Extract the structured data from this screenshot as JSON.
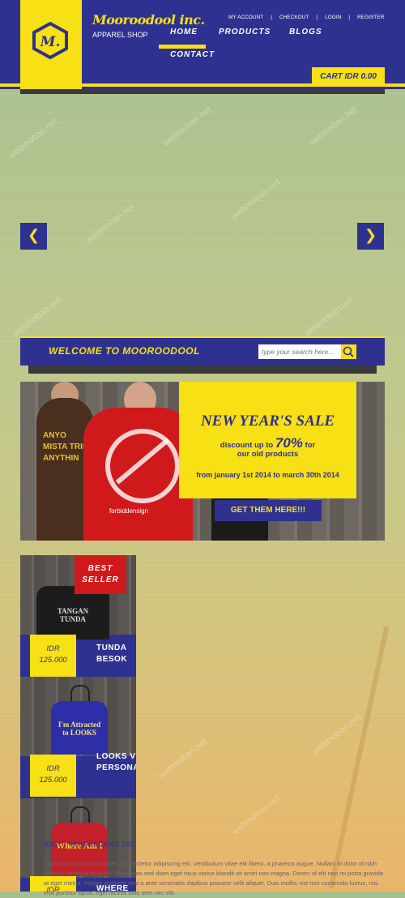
{
  "header": {
    "brand": "Mooroodool inc.",
    "logo_mark": "M.",
    "tagline": "APPAREL SHOP",
    "top_links": [
      "MY ACCOUNT",
      "CHECKOUT",
      "LOGIN",
      "REGISTER"
    ],
    "nav": [
      "HOME",
      "PRODUCTS",
      "BLOGS",
      "CONTACT"
    ],
    "cart_label": "CART IDR 0.00"
  },
  "slider": {
    "prev_icon": "chevron-left-icon",
    "next_icon": "chevron-right-icon",
    "prev": "❮",
    "next": "❯"
  },
  "welcome": {
    "text": "WELCOME TO MOOROODOOL",
    "search_placeholder": "type your search here..."
  },
  "promo": {
    "title": "NEW YEAR'S SALE",
    "line1_pre": "discount up to",
    "percent": "70%",
    "line1_post": "for",
    "line2": "our old products",
    "dates": "from january 1st 2014 to march 30th 2014",
    "cta": "GET THEM HERE!!!",
    "shirt1_text": "ANYO MISTA TRIM ANYTHIN",
    "shirt2_text": "forbiddensign"
  },
  "products": [
    {
      "badge": "BEST SELLER",
      "currency": "IDR",
      "price": "125.000",
      "name": "TUNDA BESOK",
      "shirt_text": "TANGAN TUNDA"
    },
    {
      "currency": "IDR",
      "price": "125.000",
      "name": "LOOKS VS PERSONALITY",
      "shirt_text": "I'm Attracted to LOOKS"
    },
    {
      "currency": "IDR",
      "price": "",
      "name": "WHERE",
      "shirt_text": "Where Am I"
    }
  ],
  "footer": {
    "title": "ABOUT MOOROODOOL INC.",
    "text": "Lorem ipsum dolor sit amet, consectetur adipiscing elit. Vestibulum vitae elit libero, a pharetra augue. Nullam id dolor id nibh ultricies vehicula ut id elit. Maecenas sed diam eget risus varius blandit sit amet non magna. Donec id elit non mi porta gravida at eget metus. Integer posuere erat a ante venenatis dapibus posuere velit aliquet. Duis mollis, est non commodo luctus, nisi erat porttitor ligula, eget lacinia odio sem nec elit."
  },
  "watermark": "webmoban.net",
  "colors": {
    "navy": "#2e3190",
    "yellow": "#f7e013",
    "red": "#d0191b"
  }
}
